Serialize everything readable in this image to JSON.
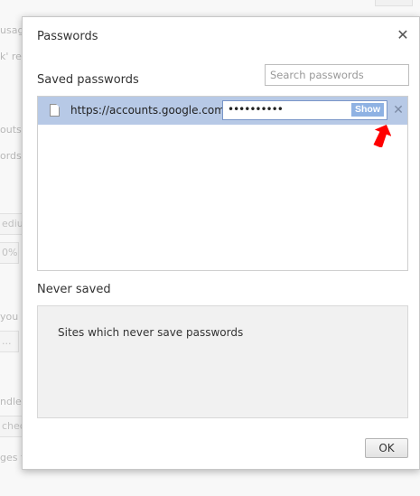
{
  "background": {
    "fragments": [
      "usag",
      "k' re",
      "outs",
      "ords",
      "ediu",
      "0%",
      "you",
      "...",
      "ndle",
      "chec",
      "ges t"
    ]
  },
  "dialog": {
    "title": "Passwords",
    "close_icon": "close-icon",
    "saved_section": {
      "label": "Saved passwords",
      "search_placeholder": "Search passwords",
      "entries": [
        {
          "site": "https://accounts.google.com/",
          "password_mask": "••••••••••",
          "show_label": "Show",
          "icon": "document-icon",
          "remove_icon": "remove-icon"
        }
      ]
    },
    "annotation": {
      "icon": "red-arrow-icon",
      "color": "#ff0000"
    },
    "never_section": {
      "label": "Never saved",
      "placeholder_text": "Sites which never save passwords"
    },
    "ok_label": "OK"
  },
  "colors": {
    "selected_row": "#b7c9e6",
    "show_button": "#8fb2e3"
  }
}
